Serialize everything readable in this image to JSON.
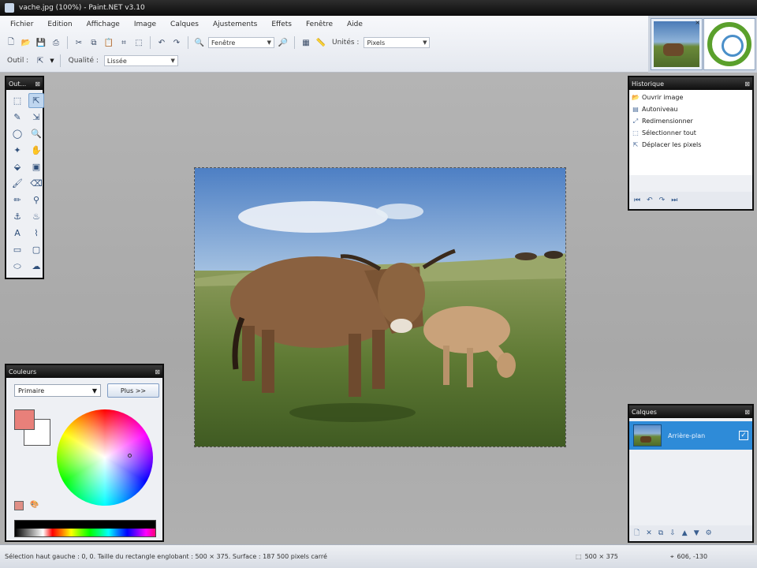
{
  "window": {
    "title": "vache.jpg (100%) - Paint.NET v3.10"
  },
  "menu": [
    "Fichier",
    "Edition",
    "Affichage",
    "Image",
    "Calques",
    "Ajustements",
    "Effets",
    "Fenêtre",
    "Aide"
  ],
  "toolbar": {
    "zoom_label": "Fenêtre",
    "units_label": "Unités :",
    "units_value": "Pixels"
  },
  "tool_options": {
    "tool_label": "Outil :",
    "quality_label": "Qualité :",
    "quality_value": "Lissée"
  },
  "tools_panel": {
    "title": "Out..."
  },
  "history_panel": {
    "title": "Historique",
    "items": [
      "Ouvrir image",
      "Autoniveau",
      "Redimensionner",
      "Sélectionner tout",
      "Déplacer les pixels"
    ]
  },
  "colors_panel": {
    "title": "Couleurs",
    "mode": "Primaire",
    "more_button": "Plus >>",
    "primary_color": "#e8807a",
    "secondary_color": "#ffffff"
  },
  "layers_panel": {
    "title": "Calques",
    "layer_name": "Arrière-plan"
  },
  "status": {
    "text": "Sélection haut gauche : 0, 0. Taille du rectangle englobant : 500 × 375. Surface : 187 500 pixels carré",
    "size": "500 × 375",
    "position": "606, -130"
  },
  "colors": {
    "titlebar": "#0c0c0c",
    "workspace": "#aaaaaa",
    "accent": "#2e8bd8"
  }
}
